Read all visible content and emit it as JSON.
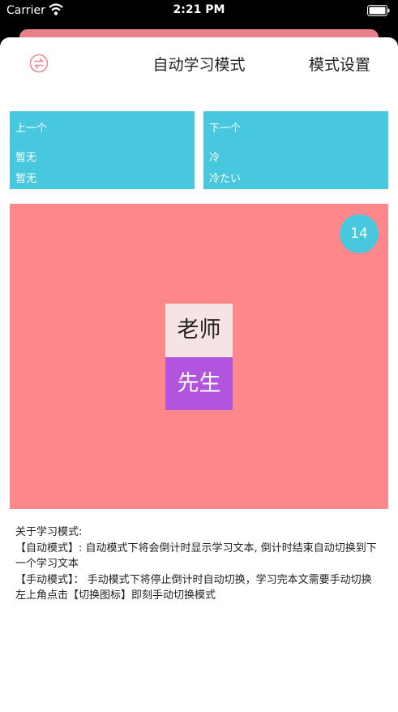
{
  "status_bar": {
    "carrier": "Carrier",
    "time": "2:21 PM"
  },
  "nav": {
    "title": "自动学习模式",
    "settings_label": "模式设置",
    "switch_icon": "switch-arrows-icon"
  },
  "prev_card": {
    "label": "上一个",
    "line1": "暂无",
    "line2": "暂无"
  },
  "next_card": {
    "label": "下一个",
    "line1": "冷",
    "line2": "冷たい"
  },
  "main": {
    "countdown": "14",
    "word_top": "老师",
    "word_bottom": "先生"
  },
  "info": {
    "line1": "关于学习模式:",
    "line2": "【自动模式】: 自动模式下将会倒计时显示学习文本, 倒计时结束自动切换到下一个学习文本",
    "line3": "【手动模式】： 手动模式下将停止倒计时自动切换，学习完本文需要手动切换",
    "line4": "左上角点击【切换图标】即刻手动切换模式"
  },
  "colors": {
    "accent_blue": "#48c8de",
    "main_pink": "#fe878b",
    "word_purple": "#b154de",
    "word_light": "#f6e4e4"
  }
}
